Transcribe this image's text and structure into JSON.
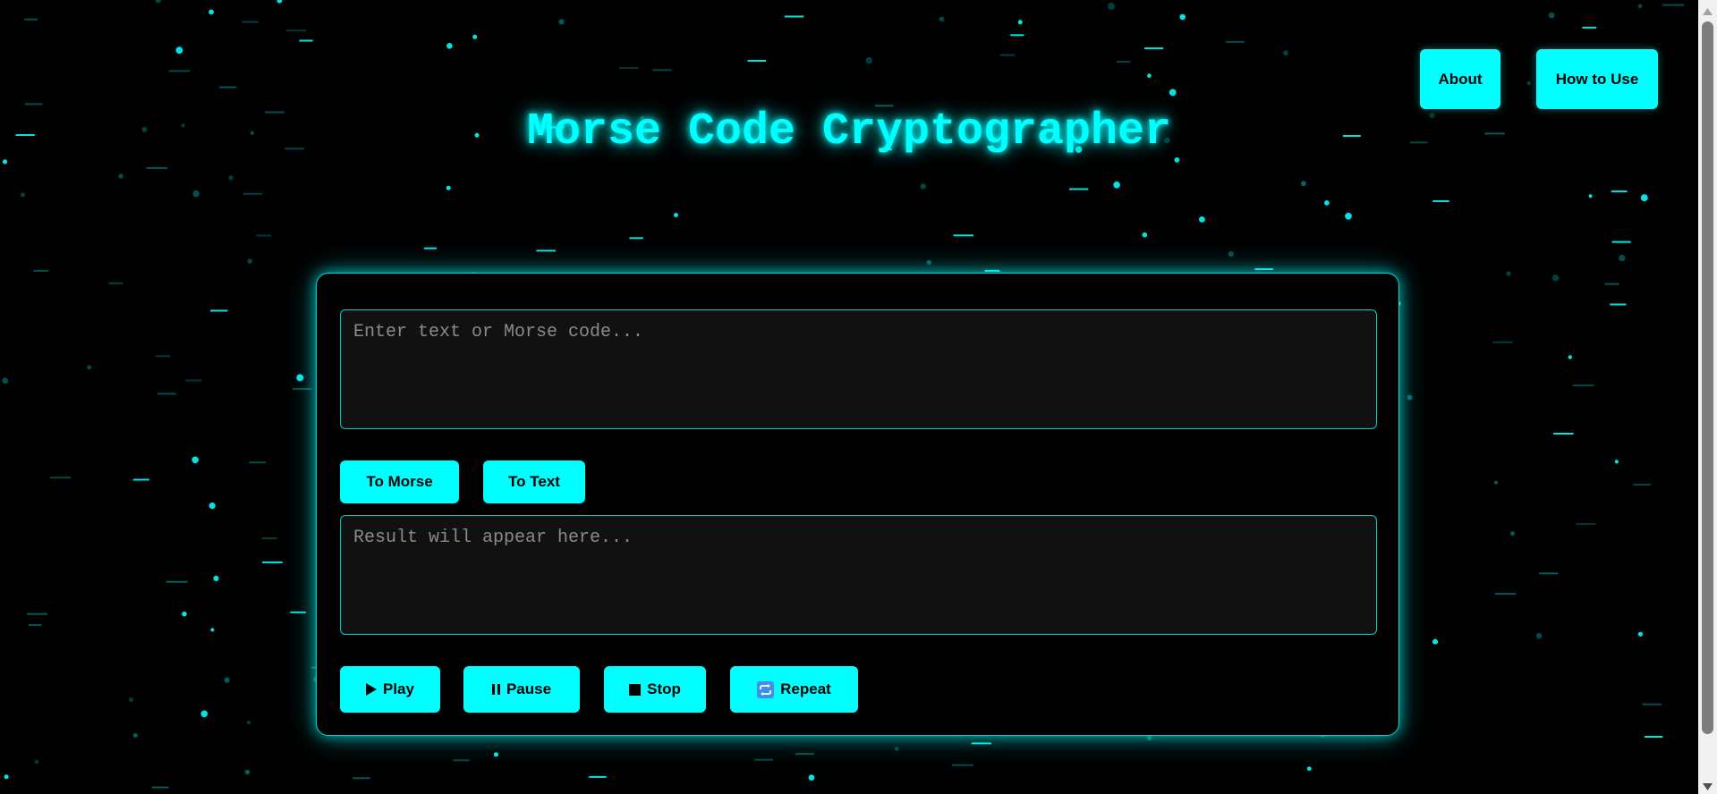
{
  "app": {
    "title": "Morse Code Cryptographer"
  },
  "nav": {
    "about_label": "About",
    "howto_label": "How to Use"
  },
  "converter": {
    "input_placeholder": "Enter text or Morse code...",
    "input_value": "",
    "output_placeholder": "Result will appear here...",
    "output_value": "",
    "to_morse_label": "To Morse",
    "to_text_label": "To Text"
  },
  "playback": {
    "play_label": "Play",
    "pause_label": "Pause",
    "stop_label": "Stop",
    "repeat_label": "Repeat",
    "icons": {
      "play": "play-triangle-icon",
      "pause": "pause-bars-icon",
      "stop": "stop-square-icon",
      "repeat": "repeat-arrows-icon"
    }
  },
  "colors": {
    "background": "#000000",
    "accent": "#00ffff",
    "panel_border": "#00d5d5",
    "field_background": "#111111",
    "placeholder_text": "#8a8a8a",
    "repeat_icon_bg": "#3f8fe8"
  }
}
